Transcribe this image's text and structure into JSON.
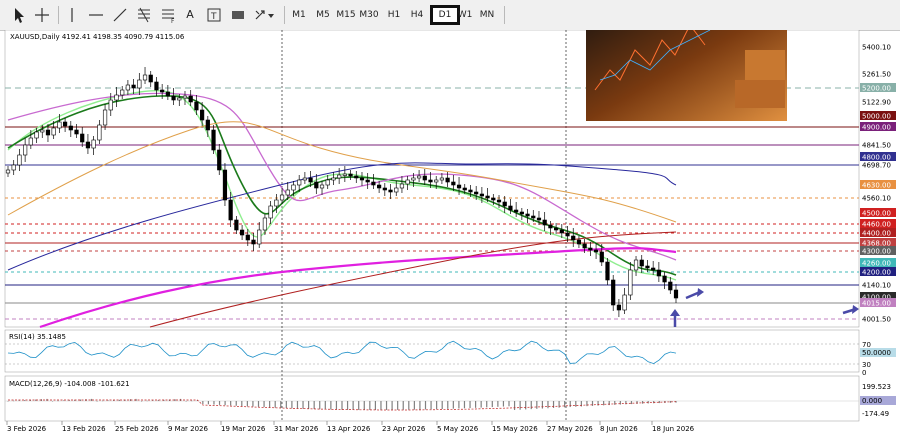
{
  "toolbar": {
    "tools": [
      "cursor-arrow-icon",
      "crosshair-icon",
      "vertical-line-icon",
      "horizontal-line-icon",
      "trendline-icon",
      "grid-lines-icon",
      "fibonacci-icon",
      "text-icon",
      "text-label-icon",
      "rectangle-label-icon",
      "arrow-dropdown-icon"
    ],
    "timeframes": [
      "M1",
      "M5",
      "M15",
      "M30",
      "H1",
      "H4",
      "D1",
      "W1",
      "MN"
    ],
    "active_timeframe": "D1"
  },
  "chart": {
    "header": "XAUUSD,Daily  4192.41 4198.35 4090.79 4115.06",
    "price_labels": [
      "5400.10",
      "5261.50",
      "5200.00",
      "5122.90",
      "5000.00",
      "4900.00",
      "4841.50",
      "4800.00",
      "4698.70",
      "4630.00",
      "4560.10",
      "4500.00",
      "4460.00",
      "4400.00",
      "4368.00",
      "4300.00",
      "4260.00",
      "4200.00",
      "4140.10",
      "4100.00",
      "4015.00",
      "4001.50"
    ],
    "date_labels": [
      "3 Feb 2026",
      "13 Feb 2026",
      "25 Feb 2026",
      "9 Mar 2026",
      "19 Mar 2026",
      "31 Mar 2026",
      "13 Apr 2026",
      "23 Apr 2026",
      "5 May 2026",
      "15 May 2026",
      "27 May 2026",
      "8 Jun 2026",
      "18 Jun 2026"
    ]
  },
  "rsi": {
    "label": "RSI(14) 35.1485",
    "scale": [
      "70",
      "50.0000",
      "30",
      "0"
    ]
  },
  "macd": {
    "label": "MACD(12,26,9) -104.008 -101.621",
    "scale": [
      "199.523",
      "0.000",
      "-174.49"
    ]
  },
  "colors": {
    "bull": "#ffffff",
    "bear": "#000000",
    "ma_green": "#1b7a1b",
    "ma_lightgreen": "#90ee90",
    "ma_violet": "#c86ad0",
    "ma_orange": "#e0a04a",
    "ma_blue": "#28289c",
    "ma_magenta": "#e020e0",
    "ma_red": "#b02020",
    "arrow": "#4a4aa8"
  }
}
